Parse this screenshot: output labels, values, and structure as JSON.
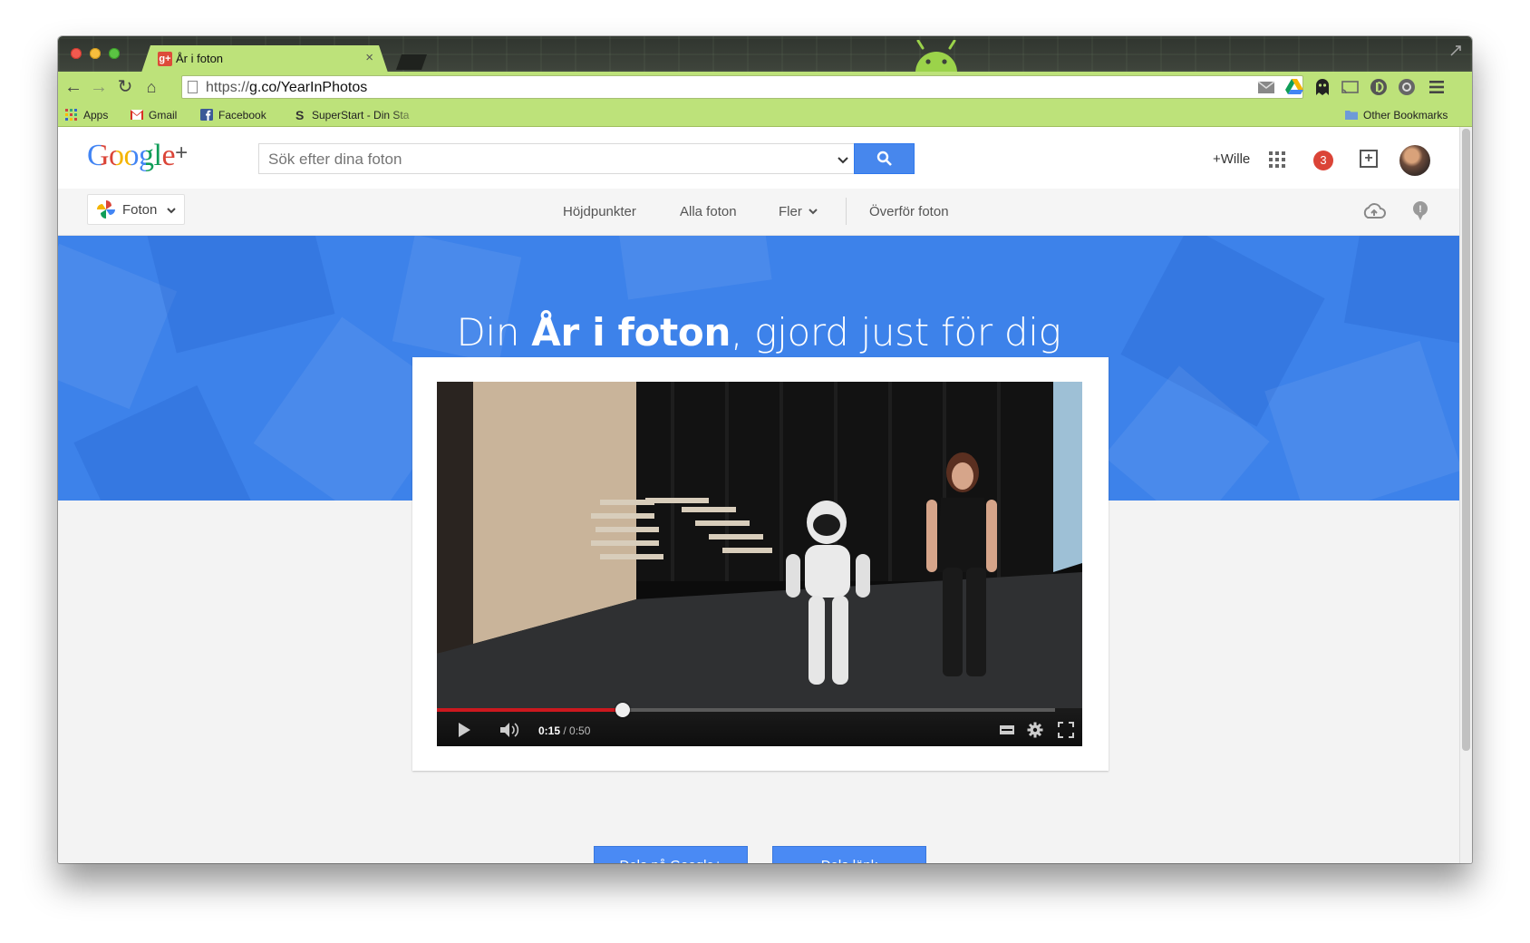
{
  "browser": {
    "tab_title": "År i foton",
    "tab_favicon": "g+",
    "url_prefix": "https://",
    "url_host": "g.co",
    "url_path": "/YearInPhotos",
    "bookmarks": [
      {
        "label": "Apps",
        "icon": "apps-grid-icon"
      },
      {
        "label": "Gmail",
        "icon": "gmail-icon"
      },
      {
        "label": "Facebook",
        "icon": "facebook-icon"
      },
      {
        "label": "SuperStart - Din Sta",
        "icon": "superstart-icon"
      }
    ],
    "other_bookmarks": "Other Bookmarks",
    "accent_color": "#bde27a"
  },
  "gplus": {
    "logo_google": "Google",
    "logo_plus": "+",
    "search_placeholder": "Sök efter dina foton",
    "user": "+Wille",
    "notifications": "3"
  },
  "subnav": {
    "app_label": "Foton",
    "links": [
      "Höjdpunkter",
      "Alla foton",
      "Fler",
      "Överför foton"
    ]
  },
  "hero": {
    "title_pre": "Din ",
    "title_bold": "År i foton",
    "title_post": ", gjord just för dig",
    "color": "#3d82ea"
  },
  "video": {
    "time_current": "0:15",
    "time_total": " / 0:50",
    "progress": 0.3
  },
  "actions": {
    "share_gplus": "Dela på Google+",
    "share_link": "Dela länk"
  }
}
